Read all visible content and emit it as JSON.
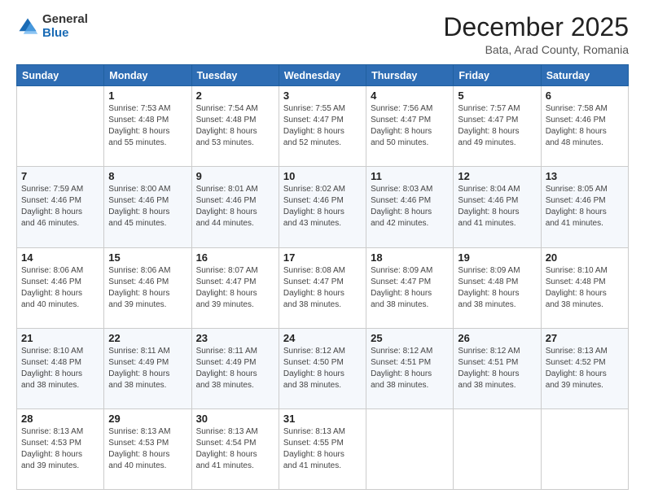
{
  "header": {
    "logo": {
      "general": "General",
      "blue": "Blue"
    },
    "title": "December 2025",
    "location": "Bata, Arad County, Romania"
  },
  "weekdays": [
    "Sunday",
    "Monday",
    "Tuesday",
    "Wednesday",
    "Thursday",
    "Friday",
    "Saturday"
  ],
  "weeks": [
    [
      {
        "day": "",
        "info": ""
      },
      {
        "day": "1",
        "info": "Sunrise: 7:53 AM\nSunset: 4:48 PM\nDaylight: 8 hours\nand 55 minutes."
      },
      {
        "day": "2",
        "info": "Sunrise: 7:54 AM\nSunset: 4:48 PM\nDaylight: 8 hours\nand 53 minutes."
      },
      {
        "day": "3",
        "info": "Sunrise: 7:55 AM\nSunset: 4:47 PM\nDaylight: 8 hours\nand 52 minutes."
      },
      {
        "day": "4",
        "info": "Sunrise: 7:56 AM\nSunset: 4:47 PM\nDaylight: 8 hours\nand 50 minutes."
      },
      {
        "day": "5",
        "info": "Sunrise: 7:57 AM\nSunset: 4:47 PM\nDaylight: 8 hours\nand 49 minutes."
      },
      {
        "day": "6",
        "info": "Sunrise: 7:58 AM\nSunset: 4:46 PM\nDaylight: 8 hours\nand 48 minutes."
      }
    ],
    [
      {
        "day": "7",
        "info": "Sunrise: 7:59 AM\nSunset: 4:46 PM\nDaylight: 8 hours\nand 46 minutes."
      },
      {
        "day": "8",
        "info": "Sunrise: 8:00 AM\nSunset: 4:46 PM\nDaylight: 8 hours\nand 45 minutes."
      },
      {
        "day": "9",
        "info": "Sunrise: 8:01 AM\nSunset: 4:46 PM\nDaylight: 8 hours\nand 44 minutes."
      },
      {
        "day": "10",
        "info": "Sunrise: 8:02 AM\nSunset: 4:46 PM\nDaylight: 8 hours\nand 43 minutes."
      },
      {
        "day": "11",
        "info": "Sunrise: 8:03 AM\nSunset: 4:46 PM\nDaylight: 8 hours\nand 42 minutes."
      },
      {
        "day": "12",
        "info": "Sunrise: 8:04 AM\nSunset: 4:46 PM\nDaylight: 8 hours\nand 41 minutes."
      },
      {
        "day": "13",
        "info": "Sunrise: 8:05 AM\nSunset: 4:46 PM\nDaylight: 8 hours\nand 41 minutes."
      }
    ],
    [
      {
        "day": "14",
        "info": "Sunrise: 8:06 AM\nSunset: 4:46 PM\nDaylight: 8 hours\nand 40 minutes."
      },
      {
        "day": "15",
        "info": "Sunrise: 8:06 AM\nSunset: 4:46 PM\nDaylight: 8 hours\nand 39 minutes."
      },
      {
        "day": "16",
        "info": "Sunrise: 8:07 AM\nSunset: 4:47 PM\nDaylight: 8 hours\nand 39 minutes."
      },
      {
        "day": "17",
        "info": "Sunrise: 8:08 AM\nSunset: 4:47 PM\nDaylight: 8 hours\nand 38 minutes."
      },
      {
        "day": "18",
        "info": "Sunrise: 8:09 AM\nSunset: 4:47 PM\nDaylight: 8 hours\nand 38 minutes."
      },
      {
        "day": "19",
        "info": "Sunrise: 8:09 AM\nSunset: 4:48 PM\nDaylight: 8 hours\nand 38 minutes."
      },
      {
        "day": "20",
        "info": "Sunrise: 8:10 AM\nSunset: 4:48 PM\nDaylight: 8 hours\nand 38 minutes."
      }
    ],
    [
      {
        "day": "21",
        "info": "Sunrise: 8:10 AM\nSunset: 4:48 PM\nDaylight: 8 hours\nand 38 minutes."
      },
      {
        "day": "22",
        "info": "Sunrise: 8:11 AM\nSunset: 4:49 PM\nDaylight: 8 hours\nand 38 minutes."
      },
      {
        "day": "23",
        "info": "Sunrise: 8:11 AM\nSunset: 4:49 PM\nDaylight: 8 hours\nand 38 minutes."
      },
      {
        "day": "24",
        "info": "Sunrise: 8:12 AM\nSunset: 4:50 PM\nDaylight: 8 hours\nand 38 minutes."
      },
      {
        "day": "25",
        "info": "Sunrise: 8:12 AM\nSunset: 4:51 PM\nDaylight: 8 hours\nand 38 minutes."
      },
      {
        "day": "26",
        "info": "Sunrise: 8:12 AM\nSunset: 4:51 PM\nDaylight: 8 hours\nand 38 minutes."
      },
      {
        "day": "27",
        "info": "Sunrise: 8:13 AM\nSunset: 4:52 PM\nDaylight: 8 hours\nand 39 minutes."
      }
    ],
    [
      {
        "day": "28",
        "info": "Sunrise: 8:13 AM\nSunset: 4:53 PM\nDaylight: 8 hours\nand 39 minutes."
      },
      {
        "day": "29",
        "info": "Sunrise: 8:13 AM\nSunset: 4:53 PM\nDaylight: 8 hours\nand 40 minutes."
      },
      {
        "day": "30",
        "info": "Sunrise: 8:13 AM\nSunset: 4:54 PM\nDaylight: 8 hours\nand 41 minutes."
      },
      {
        "day": "31",
        "info": "Sunrise: 8:13 AM\nSunset: 4:55 PM\nDaylight: 8 hours\nand 41 minutes."
      },
      {
        "day": "",
        "info": ""
      },
      {
        "day": "",
        "info": ""
      },
      {
        "day": "",
        "info": ""
      }
    ]
  ]
}
